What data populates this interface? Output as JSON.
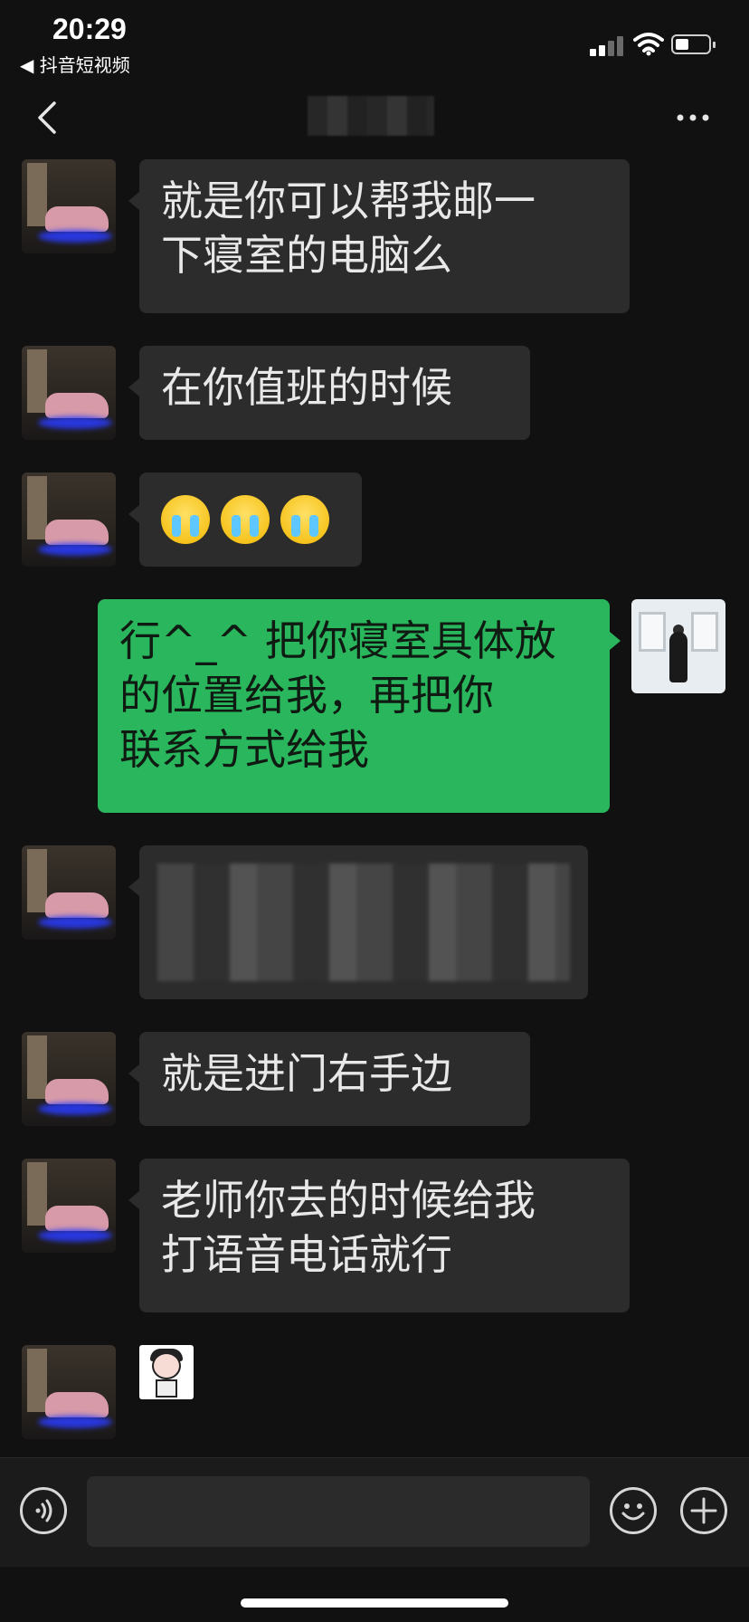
{
  "status_bar": {
    "time": "20:29",
    "back_app_label": "◀ 抖音短视频",
    "signal_icon": "signal-icon",
    "wifi_icon": "wifi-icon",
    "battery_icon": "battery-icon"
  },
  "nav_bar": {
    "back_icon": "chevron-left-icon",
    "title": "",
    "more_icon": "more-icon"
  },
  "messages": [
    {
      "sender": "other",
      "text": "就是你可以帮我邮一\n下寝室的电脑么"
    },
    {
      "sender": "other",
      "text": "在你值班的时候"
    },
    {
      "sender": "other",
      "emojis": [
        "crying-face",
        "crying-face",
        "crying-face"
      ]
    },
    {
      "sender": "me",
      "text": "行^_^ 把你寝室具体放\n的位置给我，再把你\n联系方式给我"
    },
    {
      "sender": "other",
      "text": ""
    },
    {
      "sender": "other",
      "text": "就是进门右手边"
    },
    {
      "sender": "other",
      "text": "老师你去的时候给我\n打语音电话就行"
    },
    {
      "sender": "other",
      "sticker": "cartoon-sticker"
    }
  ],
  "input_bar": {
    "voice_icon": "voice-icon",
    "emoji_icon": "emoji-icon",
    "plus_icon": "plus-icon",
    "input_value": ""
  },
  "colors": {
    "background": "#111111",
    "bubble_other": "#2c2c2c",
    "bubble_me": "#29b65c"
  }
}
